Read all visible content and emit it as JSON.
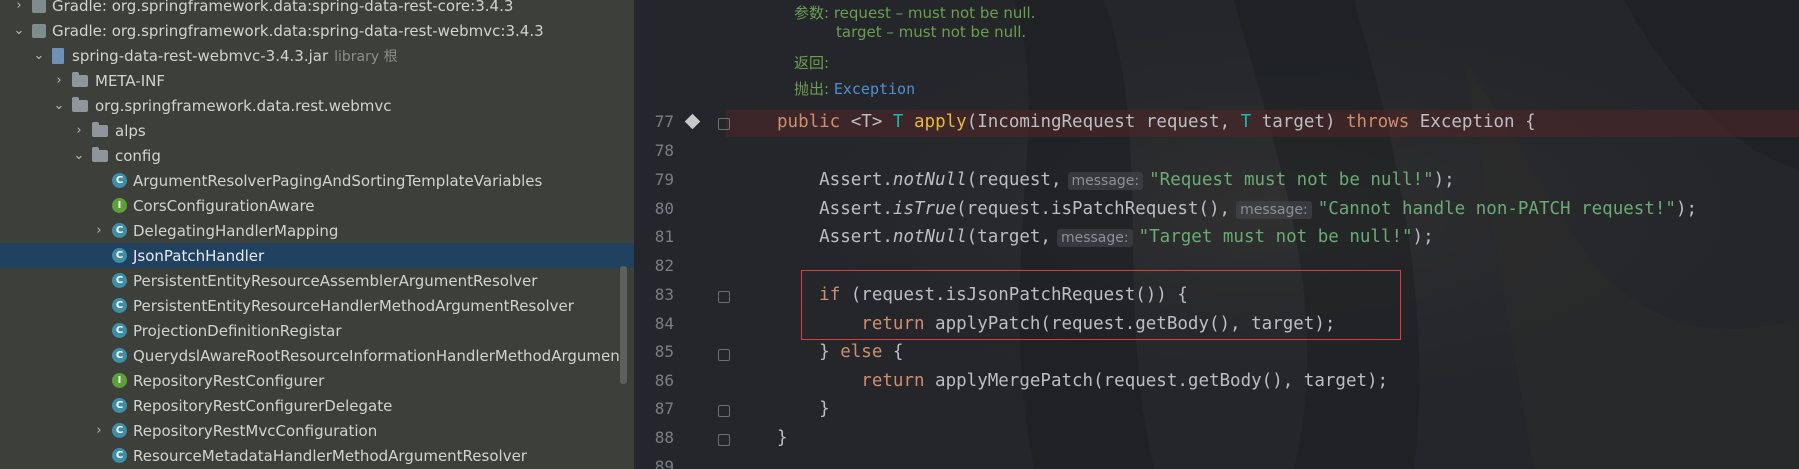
{
  "tree": {
    "rows": [
      {
        "label": "Gradle: org.springframework.data:spring-data-rest-core:3.4.3",
        "arrow": "›",
        "icon": "gradle-library-icon",
        "indent": 0
      },
      {
        "label": "Gradle: org.springframework.data:spring-data-rest-webmvc:3.4.3",
        "arrow": "⌄",
        "icon": "gradle-library-icon",
        "indent": 0
      },
      {
        "label": "spring-data-rest-webmvc-3.4.3.jar",
        "suffix": "library 根",
        "arrow": "⌄",
        "icon": "jar-icon",
        "indent": 1
      },
      {
        "label": "META-INF",
        "arrow": "›",
        "icon": "folder-icon",
        "indent": 2
      },
      {
        "label": "org.springframework.data.rest.webmvc",
        "arrow": "⌄",
        "icon": "folder-icon",
        "indent": 2
      },
      {
        "label": "alps",
        "arrow": "›",
        "icon": "folder-icon",
        "indent": 3
      },
      {
        "label": "config",
        "arrow": "⌄",
        "icon": "folder-icon",
        "indent": 3
      },
      {
        "label": "ArgumentResolverPagingAndSortingTemplateVariables",
        "arrow": "",
        "icon": "class-icon",
        "indent": 4
      },
      {
        "label": "CorsConfigurationAware",
        "arrow": "",
        "icon": "interface-icon",
        "indent": 4
      },
      {
        "label": "DelegatingHandlerMapping",
        "arrow": "›",
        "icon": "class-icon",
        "indent": 4
      },
      {
        "label": "JsonPatchHandler",
        "arrow": "",
        "icon": "class-icon",
        "indent": 4,
        "selected": true
      },
      {
        "label": "PersistentEntityResourceAssemblerArgumentResolver",
        "arrow": "",
        "icon": "class-icon",
        "indent": 4
      },
      {
        "label": "PersistentEntityResourceHandlerMethodArgumentResolver",
        "arrow": "",
        "icon": "class-icon",
        "indent": 4
      },
      {
        "label": "ProjectionDefinitionRegistar",
        "arrow": "",
        "icon": "class-icon",
        "indent": 4
      },
      {
        "label": "QuerydslAwareRootResourceInformationHandlerMethodArgument",
        "arrow": "",
        "icon": "class-icon",
        "indent": 4
      },
      {
        "label": "RepositoryRestConfigurer",
        "arrow": "",
        "icon": "interface-icon",
        "indent": 4
      },
      {
        "label": "RepositoryRestConfigurerDelegate",
        "arrow": "",
        "icon": "class-icon",
        "indent": 4
      },
      {
        "label": "RepositoryRestMvcConfiguration",
        "arrow": "›",
        "icon": "class-icon",
        "indent": 4
      },
      {
        "label": "ResourceMetadataHandlerMethodArgumentResolver",
        "arrow": "",
        "icon": "class-icon",
        "indent": 4
      }
    ]
  },
  "doc": {
    "params_label": "参数:",
    "param1": "request – must not be null.",
    "param2": "target – must not be null.",
    "returns_label": "返回:",
    "throws_label": "抛出:",
    "throws_value": "Exception"
  },
  "editor": {
    "line_numbers": [
      "77",
      "78",
      "79",
      "80",
      "81",
      "82",
      "83",
      "84",
      "85",
      "86",
      "87",
      "88",
      "89"
    ],
    "hint_message": "message:",
    "l77": {
      "public": "public",
      "generic": "<T>",
      "t": "T",
      "apply": "apply",
      "params_a": "(IncomingRequest request, ",
      "t2": "T",
      "params_b": " target) ",
      "throws": "throws",
      "rest": " Exception {"
    },
    "l79": {
      "pre": "    Assert.",
      "method": "notNull",
      "args": "(request,",
      "str": "\"Request must not be null!\"",
      "end": ");"
    },
    "l80": {
      "pre": "    Assert.",
      "method": "isTrue",
      "args": "(request.isPatchRequest(),",
      "str": "\"Cannot handle non-PATCH request!\"",
      "end": ");"
    },
    "l81": {
      "pre": "    Assert.",
      "method": "notNull",
      "args": "(target,",
      "str": "\"Target must not be null!\"",
      "end": ");"
    },
    "l83": {
      "if": "if",
      "rest": " (request.isJsonPatchRequest()) {"
    },
    "l84": {
      "return": "return",
      "rest": " applyPatch(request.getBody(), target);"
    },
    "l85": {
      "pre": "    } ",
      "else": "else",
      "rest": " {"
    },
    "l86": {
      "return": "return",
      "rest": " applyMergePatch(request.getBody(), target);"
    },
    "l87": "    }",
    "l88": "}"
  }
}
